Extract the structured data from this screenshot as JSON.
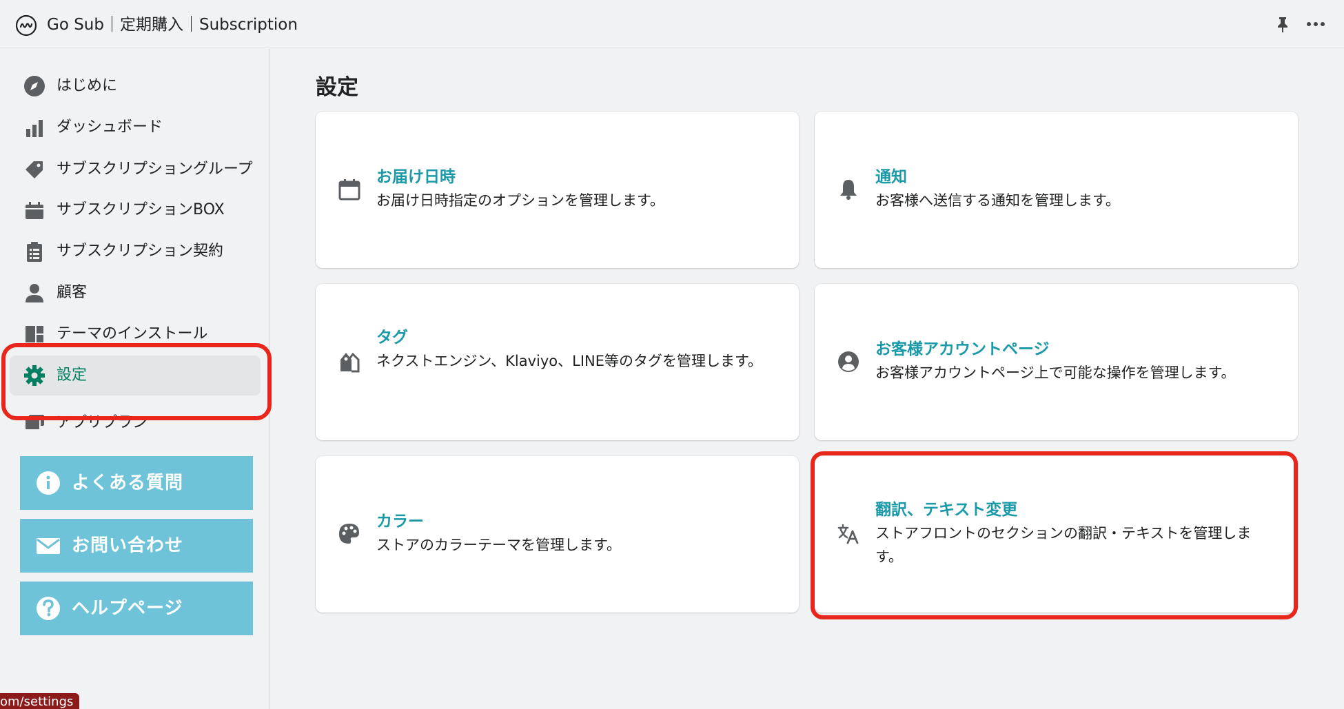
{
  "app": {
    "title": "Go Sub｜定期購入｜Subscription"
  },
  "sidebar": {
    "items": [
      {
        "label": "はじめに"
      },
      {
        "label": "ダッシュボード"
      },
      {
        "label": "サブスクリプショングループ"
      },
      {
        "label": "サブスクリプションBOX"
      },
      {
        "label": "サブスクリプション契約"
      },
      {
        "label": "顧客"
      },
      {
        "label": "テーマのインストール"
      },
      {
        "label": "設定"
      },
      {
        "label": "アプリプラン"
      }
    ],
    "active_color": "#008060"
  },
  "help_buttons": [
    {
      "label": "よくある質問"
    },
    {
      "label": "お問い合わせ"
    },
    {
      "label": "ヘルプページ"
    }
  ],
  "status_url": "om/settings",
  "main": {
    "title": "設定",
    "cards": [
      {
        "title": "お届け日時",
        "desc": "お届け日時指定のオプションを管理します。"
      },
      {
        "title": "通知",
        "desc": "お客様へ送信する通知を管理します。"
      },
      {
        "title": "タグ",
        "desc": "ネクストエンジン、Klaviyo、LINE等のタグを管理します。"
      },
      {
        "title": "お客様アカウントページ",
        "desc": "お客様アカウントページ上で可能な操作を管理します。"
      },
      {
        "title": "カラー",
        "desc": "ストアのカラーテーマを管理します。"
      },
      {
        "title": "翻訳、テキスト変更",
        "desc": "ストアフロントのセクションの翻訳・テキストを管理します。"
      }
    ]
  },
  "colors": {
    "accent": "#1a9aa8",
    "help_button": "#6ec3d8",
    "highlight": "#e8261b"
  }
}
